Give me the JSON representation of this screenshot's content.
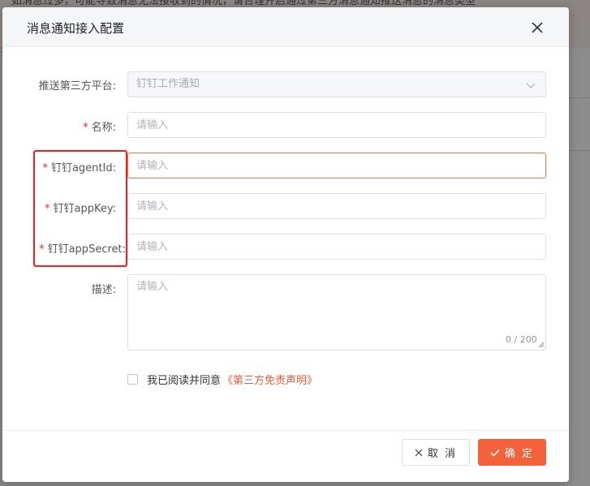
{
  "background": {
    "notice_text": "如消息过多，可能导致消息无法接收到的情况，请合理开启通过第三方消息通知推送消息的消息类型"
  },
  "dialog": {
    "title": "消息通知接入配置",
    "fields": {
      "platform": {
        "label": "推送第三方平台:",
        "value": "钉钉工作通知"
      },
      "name": {
        "label": "名称:",
        "required_mark": "*",
        "placeholder": "请输入",
        "value": ""
      },
      "agent_id": {
        "label": "钉钉agentId:",
        "required_mark": "*",
        "placeholder": "请输入",
        "value": ""
      },
      "app_key": {
        "label": "钉钉appKey:",
        "required_mark": "*",
        "placeholder": "请输入",
        "value": ""
      },
      "app_secret": {
        "label": "钉钉appSecret:",
        "required_mark": "*",
        "placeholder": "请输入",
        "value": ""
      },
      "description": {
        "label": "描述:",
        "placeholder": "请输入",
        "value": "",
        "counter": "0 / 200"
      }
    },
    "agreement": {
      "text": "我已阅读并同意",
      "link": "《第三方免责声明》",
      "checked": false
    },
    "footer": {
      "cancel_label": "取 消",
      "ok_label": "确 定"
    }
  },
  "colors": {
    "accent": "#f3623a",
    "highlight": "#ff1a1a",
    "required": "#f5222d"
  }
}
